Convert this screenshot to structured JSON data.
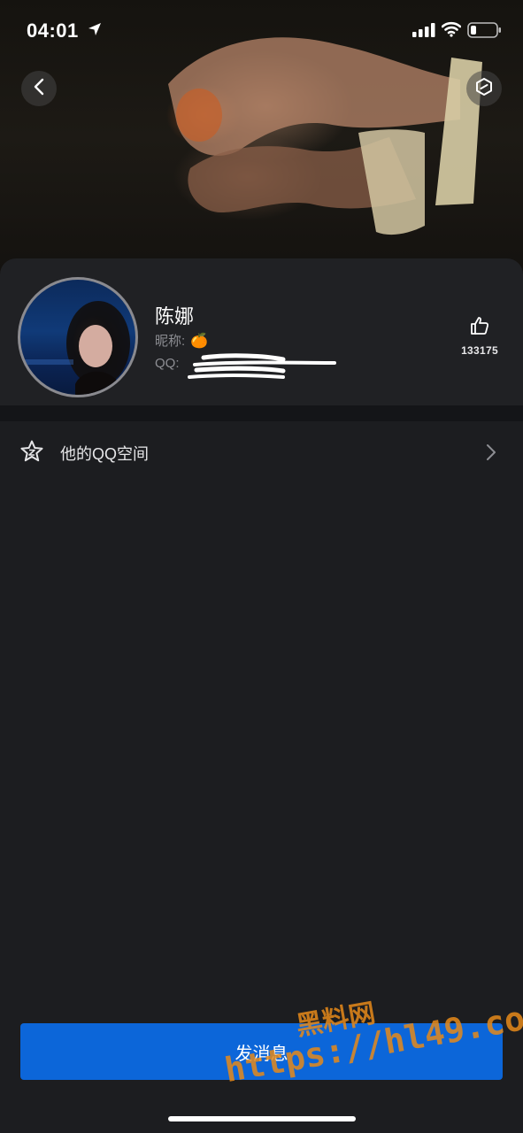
{
  "status_bar": {
    "time": "04:01",
    "location_icon": "location-arrow-icon",
    "signal_icon": "cellular-signal-icon",
    "wifi_icon": "wifi-icon",
    "battery_icon": "battery-low-icon"
  },
  "header": {
    "back_icon": "chevron-left-icon",
    "share_icon": "hexagon-link-icon"
  },
  "profile": {
    "name": "陈娜",
    "nickname_label": "昵称:",
    "nickname_value": "🍊",
    "qq_label": "QQ:",
    "like_icon": "thumbs-up-icon",
    "like_count": "133175"
  },
  "menu": {
    "qzone_label": "他的QQ空间",
    "qzone_icon": "star-z-icon",
    "chevron_icon": "chevron-right-icon"
  },
  "actions": {
    "send_message_label": "发消息"
  },
  "watermark": {
    "line1": "黑料网",
    "line2": "https://hl49.co"
  },
  "colors": {
    "background": "#1c1d20",
    "card": "#202124",
    "primary_button": "#0c66d9",
    "watermark": "#e68a1a"
  }
}
